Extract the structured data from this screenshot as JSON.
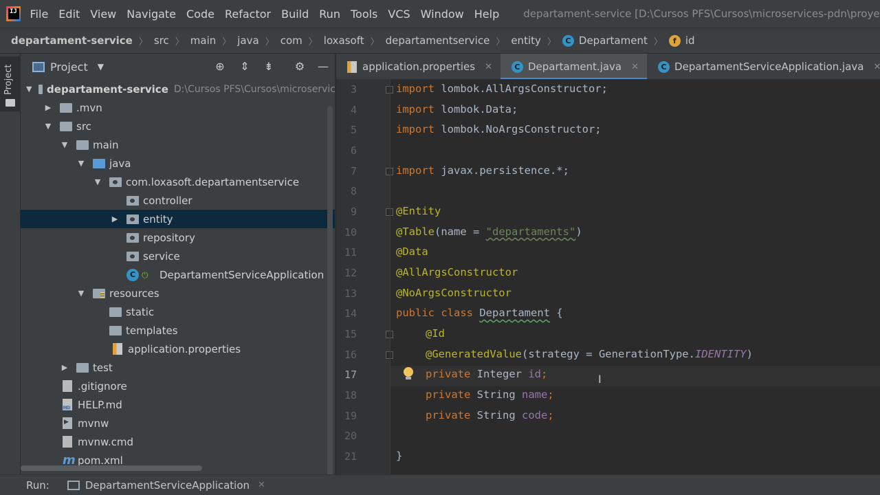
{
  "menubar": {
    "items": [
      "File",
      "Edit",
      "View",
      "Navigate",
      "Code",
      "Refactor",
      "Build",
      "Run",
      "Tools",
      "VCS",
      "Window",
      "Help"
    ],
    "window_title": "departament-service [D:\\Cursos PFS\\Cursos\\microservices-pdn\\proyecto\\d"
  },
  "breadcrumb": {
    "items": [
      "departament-service",
      "src",
      "main",
      "java",
      "com",
      "loxasoft",
      "departamentservice",
      "entity",
      "Departament",
      "id"
    ]
  },
  "toolstrip": {
    "project_label": "Project"
  },
  "project_panel": {
    "title": "Project",
    "root_path": "D:\\Cursos PFS\\Cursos\\microservic",
    "tree": [
      {
        "label": "departament-service"
      },
      {
        "label": ".mvn"
      },
      {
        "label": "src"
      },
      {
        "label": "main"
      },
      {
        "label": "java"
      },
      {
        "label": "com.loxasoft.departamentservice"
      },
      {
        "label": "controller"
      },
      {
        "label": "entity"
      },
      {
        "label": "repository"
      },
      {
        "label": "service"
      },
      {
        "label": "DepartamentServiceApplication"
      },
      {
        "label": "resources"
      },
      {
        "label": "static"
      },
      {
        "label": "templates"
      },
      {
        "label": "application.properties"
      },
      {
        "label": "test"
      },
      {
        "label": ".gitignore"
      },
      {
        "label": "HELP.md"
      },
      {
        "label": "mvnw"
      },
      {
        "label": "mvnw.cmd"
      },
      {
        "label": "pom.xml"
      }
    ]
  },
  "tabs": [
    {
      "label": "application.properties",
      "active": false
    },
    {
      "label": "Departament.java",
      "active": true
    },
    {
      "label": "DepartamentServiceApplication.java",
      "active": false
    }
  ],
  "editor": {
    "current_line": 17,
    "lines": [
      {
        "num": "3"
      },
      {
        "num": "4"
      },
      {
        "num": "5"
      },
      {
        "num": "6"
      },
      {
        "num": "7"
      },
      {
        "num": "8"
      },
      {
        "num": "9"
      },
      {
        "num": "10"
      },
      {
        "num": "11"
      },
      {
        "num": "12"
      },
      {
        "num": "13"
      },
      {
        "num": "14"
      },
      {
        "num": "15"
      },
      {
        "num": "16"
      },
      {
        "num": "17"
      },
      {
        "num": "18"
      },
      {
        "num": "19"
      },
      {
        "num": "20"
      },
      {
        "num": "21"
      }
    ],
    "code": {
      "l3_kw": "import",
      "l3_rest": " lombok.AllArgsConstructor;",
      "l4_kw": "import",
      "l4_rest": " lombok.Data;",
      "l5_kw": "import",
      "l5_rest": " lombok.NoArgsConstructor;",
      "l7_kw": "import",
      "l7_rest": " javax.persistence.*;",
      "l9_ann": "@Entity",
      "l10_ann": "@Table",
      "l10_a": "(name = ",
      "l10_str": "\"departaments\"",
      "l10_b": ")",
      "l11_ann": "@Data",
      "l12_ann": "@AllArgsConstructor",
      "l13_ann": "@NoArgsConstructor",
      "l14_kw": "public class",
      "l14_name": "Departament",
      "l14_brace": " {",
      "l15_ann": "@Id",
      "l16_ann": "@GeneratedValue",
      "l16_a": "(strategy = GenerationType.",
      "l16_const": "IDENTITY",
      "l16_b": ")",
      "l17_kw": "private",
      "l17_type": " Integer ",
      "l17_fld": "id",
      "l17_semi": ";",
      "l18_kw": "private",
      "l18_type": " String ",
      "l18_fld": "name",
      "l18_semi": ";",
      "l19_kw": "private",
      "l19_type": " String ",
      "l19_fld": "code",
      "l19_semi": ";",
      "l21": "}"
    }
  },
  "bottombar": {
    "run_label": "Run:",
    "run_tab": "DepartamentServiceApplication"
  },
  "colors": {
    "keyword": "#cc7832",
    "annotation": "#bbb529",
    "string": "#6a8759",
    "field": "#9876aa",
    "selection": "#0d293e",
    "accent": "#4a88c7"
  }
}
